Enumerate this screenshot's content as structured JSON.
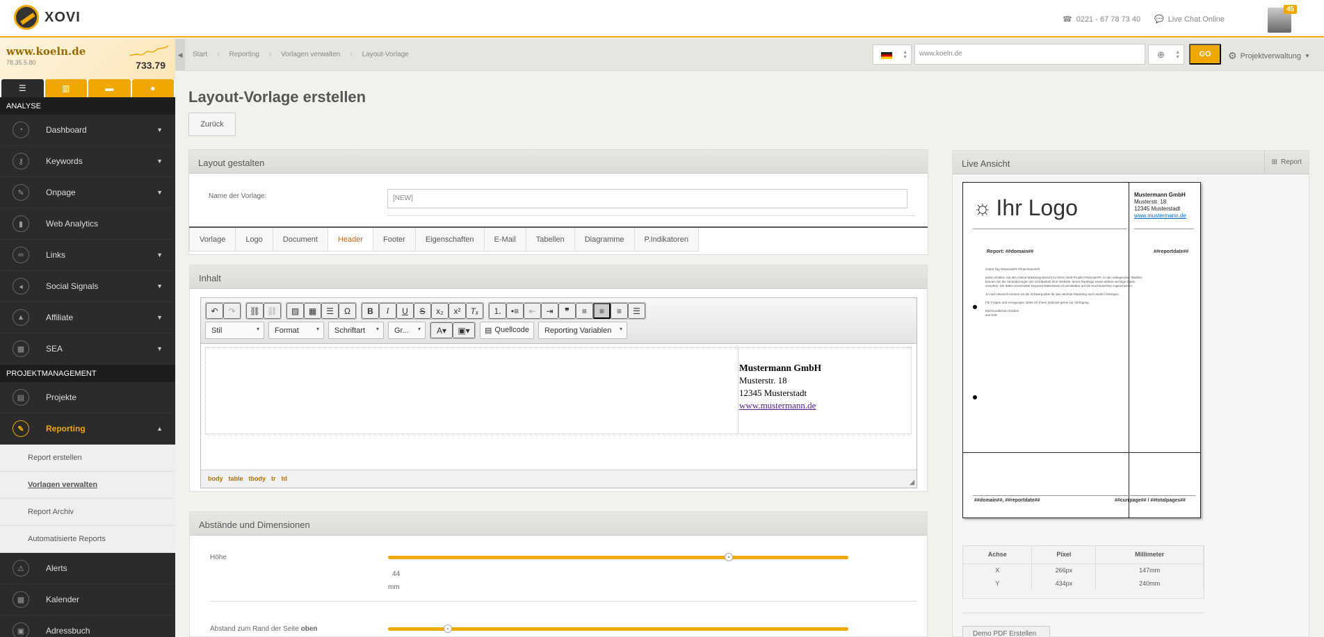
{
  "app": {
    "name": "XOVI",
    "phone": "0221 - 67 78 73 40",
    "live_chat": "Live Chat Online",
    "notifications": "45"
  },
  "site": {
    "domain": "www.koeln.de",
    "ip": "78.35.5.80",
    "score": "733.79"
  },
  "sidebar": {
    "section_analyse": "ANALYSE",
    "analyse_items": [
      {
        "label": "Dashboard",
        "icon": "dashboard-icon"
      },
      {
        "label": "Keywords",
        "icon": "key-icon"
      },
      {
        "label": "Onpage",
        "icon": "wrench-icon"
      },
      {
        "label": "Web Analytics",
        "icon": "bar-chart-icon"
      },
      {
        "label": "Links",
        "icon": "link-icon"
      },
      {
        "label": "Social Signals",
        "icon": "megaphone-icon"
      },
      {
        "label": "Affiliate",
        "icon": "affiliate-icon"
      },
      {
        "label": "SEA",
        "icon": "sea-icon"
      }
    ],
    "section_pm": "PROJEKTMANAGEMENT",
    "pm_items": [
      {
        "label": "Projekte",
        "icon": "projects-icon"
      },
      {
        "label": "Reporting",
        "icon": "reporting-icon"
      }
    ],
    "reporting_sub": [
      "Report erstellen",
      "Vorlagen verwalten",
      "Report Archiv",
      "Automatisierte Reports"
    ],
    "bottom_items": [
      {
        "label": "Alerts",
        "icon": "alert-icon"
      },
      {
        "label": "Kalender",
        "icon": "calendar-icon"
      },
      {
        "label": "Adressbuch",
        "icon": "addressbook-icon"
      }
    ]
  },
  "breadcrumb": [
    "Start",
    "Reporting",
    "Vorlagen verwalten",
    "Layout-Vorlage"
  ],
  "toolbar": {
    "url": "www.koeln.de",
    "go": "GO",
    "project_menu": "Projektverwaltung"
  },
  "page": {
    "title": "Layout-Vorlage erstellen",
    "back": "Zurück"
  },
  "layout_panel": {
    "title": "Layout gestalten",
    "name_label": "Name der Vorlage:",
    "name_value": "[NEW]",
    "tabs": [
      "Vorlage",
      "Logo",
      "Document",
      "Header",
      "Footer",
      "Eigenschaften",
      "E-Mail",
      "Tabellen",
      "Diagramme",
      "P.Indikatoren"
    ],
    "active_tab": "Header"
  },
  "inhalt": {
    "title": "Inhalt",
    "dropdowns": [
      "Stil",
      "Format",
      "Schriftart",
      "Gr...",
      "Quellcode",
      "Reporting Variablen"
    ],
    "company": "Mustermann GmbH",
    "street": "Musterstr. 18",
    "city": "12345 Musterstadt",
    "web": "www.mustermann.de",
    "path": [
      "body",
      "table",
      "tbody",
      "tr",
      "td"
    ]
  },
  "dimensions": {
    "title": "Abstände und Dimensionen",
    "hoehe_label": "Höhe",
    "hoehe_value": "44",
    "hoehe_unit": "mm",
    "hoehe_fraction": 0.74,
    "abstand_label": "Abstand zum Rand der Seite ",
    "abstand_bold": "oben",
    "abstand_fraction": 0.13
  },
  "live": {
    "title": "Live Ansicht",
    "report_btn": "Report",
    "logo_text": "Ihr Logo",
    "report_label": "Report: ##domain##",
    "reportdate": "##reportdate##",
    "footer_left": "##domain##, ##reportdate##",
    "footer_right": "##currpage## / ##totalpages##",
    "body_lines": [
      "Guten Tag ##anrede## ##nachname##,",
      "anbei erhalten Sie den Online-Marketing-Bericht zu Ihrem Web-Projekt ##domain##. In den anliegenden Tabellen können Sie die Veränderungen der Sichtbarkeit Ihrer Website, deren Rankings sowie weitere wichtige Daten einsehen. Die dabei verwendete Keyword-Datenbasis ist unmittelbar auf die Suchmaschine zugeschnitten.",
      "Je nach Wunsch können wir die Schwerpunkte für das nächste Reporting auch anders festlegen.",
      "Für Fragen und Anregungen stehe ich Ihnen jederzeit gerne zur Verfügung.",
      "Mit freundlichen Grüßen",
      "aus Köln"
    ]
  },
  "dim_table": {
    "headers": [
      "Achse",
      "Pixel",
      "Millimeter"
    ],
    "rows": [
      [
        "X",
        "266px",
        "147mm"
      ],
      [
        "Y",
        "434px",
        "240mm"
      ]
    ]
  },
  "demo_btn": "Demo PDF Erstellen",
  "colors": {
    "accent": "#f0a800",
    "sidebar": "#2b2b2b",
    "active_tab": "#c4651a"
  }
}
